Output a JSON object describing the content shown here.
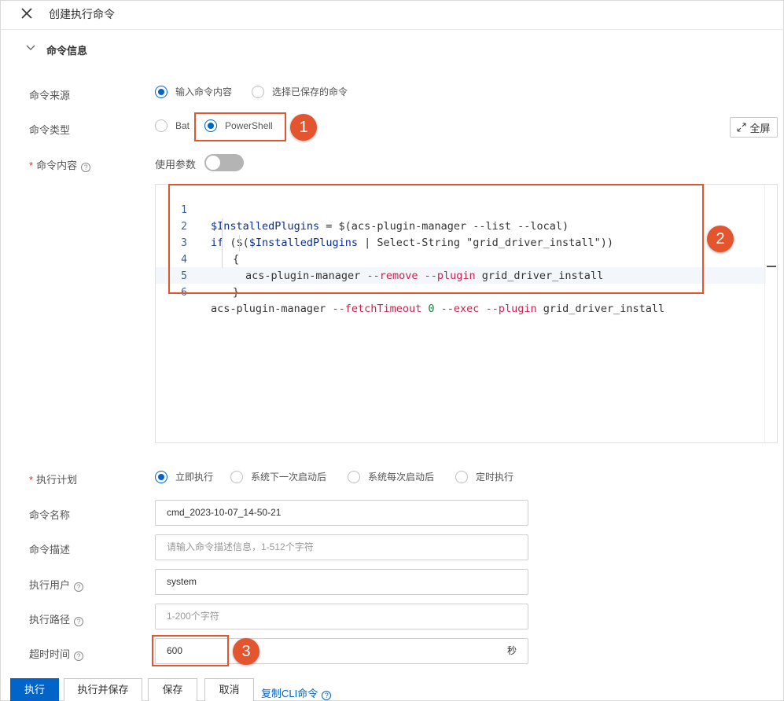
{
  "header": {
    "title": "创建执行命令"
  },
  "section": {
    "title": "命令信息"
  },
  "command_source": {
    "label": "命令来源",
    "options": [
      "输入命令内容",
      "选择已保存的命令"
    ],
    "selected": "输入命令内容"
  },
  "command_type": {
    "label": "命令类型",
    "options": [
      "Bat",
      "PowerShell"
    ],
    "selected": "PowerShell",
    "fullscreen_label": "全屏"
  },
  "command_content": {
    "label": "命令内容",
    "help_glyph": "?",
    "use_params_label": "使用参数",
    "use_params_enabled": false,
    "lines": [
      {
        "no": "1",
        "text": "$InstalledPlugins = $(acs-plugin-manager --list --local)"
      },
      {
        "no": "2",
        "text": "if ($($InstalledPlugins | Select-String \"grid_driver_install\"))"
      },
      {
        "no": "3",
        "text": "{"
      },
      {
        "no": "4",
        "text": "acs-plugin-manager --remove --plugin grid_driver_install"
      },
      {
        "no": "5",
        "text": "}"
      },
      {
        "no": "6",
        "text": "acs-plugin-manager --fetchTimeout 0 --exec --plugin grid_driver_install"
      }
    ]
  },
  "schedule": {
    "label": "执行计划",
    "options": [
      "立即执行",
      "系统下一次启动后",
      "系统每次启动后",
      "定时执行"
    ],
    "selected": "立即执行"
  },
  "command_name": {
    "label": "命令名称",
    "value": "cmd_2023-10-07_14-50-21"
  },
  "command_desc": {
    "label": "命令描述",
    "placeholder": "请输入命令描述信息，1-512个字符"
  },
  "exec_user": {
    "label": "执行用户",
    "value": "system"
  },
  "exec_path": {
    "label": "执行路径",
    "placeholder": "1-200个字符"
  },
  "timeout": {
    "label": "超时时间",
    "value": "600",
    "unit": "秒"
  },
  "annotations": [
    "1",
    "2",
    "3"
  ],
  "footer": {
    "execute": "执行",
    "execute_save": "执行并保存",
    "save": "保存",
    "cancel": "取消",
    "copy_cli": "复制CLI命令"
  },
  "colors": {
    "primary": "#0064c8",
    "annotation": "#e2552f",
    "required": "#d93026"
  }
}
